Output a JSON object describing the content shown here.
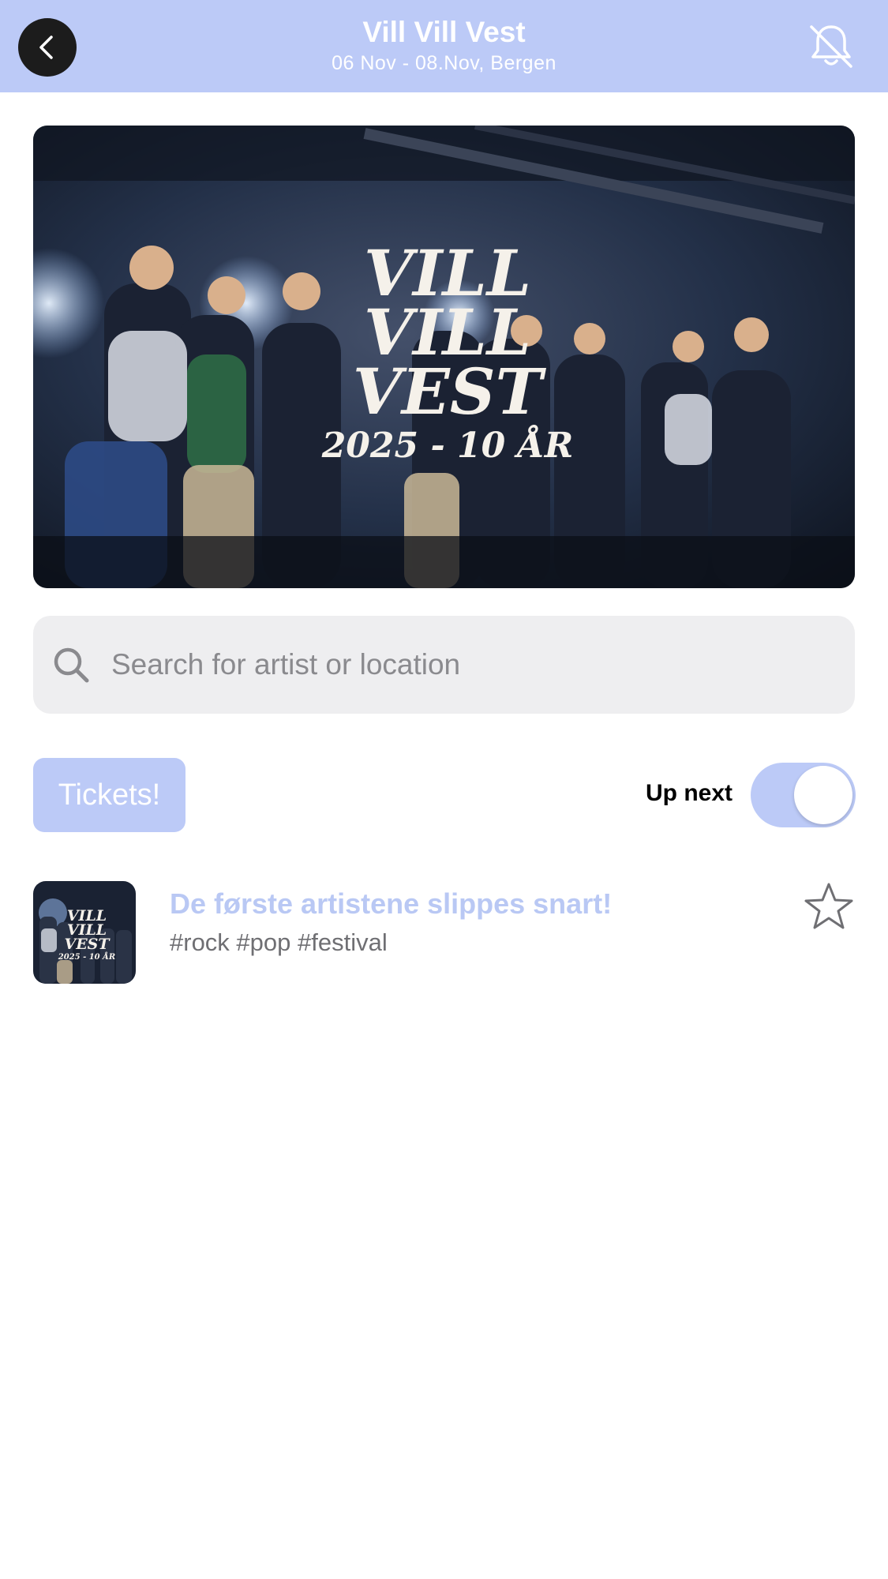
{
  "header": {
    "title": "Vill Vill Vest",
    "subtitle": "06 Nov - 08.Nov, Bergen",
    "back_icon": "chevron-left-icon",
    "notification_icon": "bell-off-icon",
    "background_color": "#bccaf7"
  },
  "hero": {
    "logo_lines": [
      "VILL",
      "VILL",
      "VEST",
      "2025 - 10 ÅR"
    ]
  },
  "search": {
    "placeholder": "Search for artist or location",
    "value": "",
    "icon": "search-icon"
  },
  "controls": {
    "tickets_label": "Tickets!",
    "up_next_label": "Up next",
    "up_next_enabled": true,
    "accent_color": "#bccaf7"
  },
  "items": [
    {
      "title": "De første artistene slippes snart!",
      "tags": "#rock #pop #festival",
      "favorite": false,
      "icon": "star-icon"
    }
  ]
}
